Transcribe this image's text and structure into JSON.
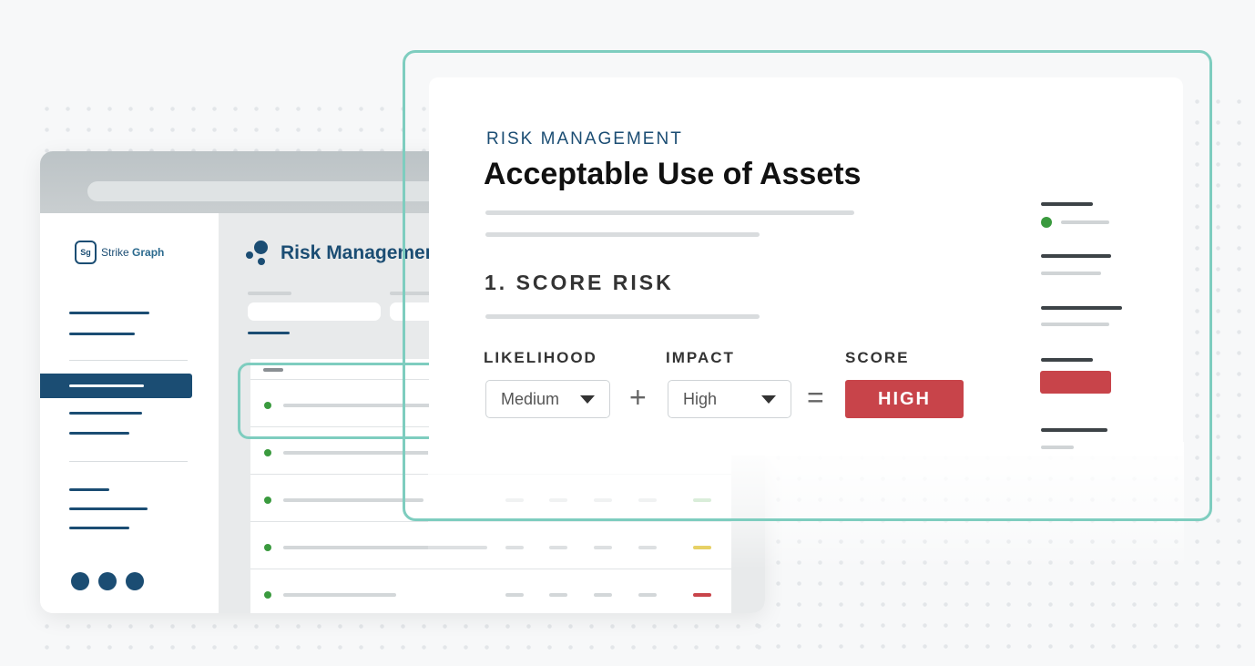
{
  "back_window": {
    "logo_mark": "Sg",
    "logo_name": "Strike ",
    "logo_name_bold": "Graph",
    "page_title": "Risk Management",
    "row_status_colors": [
      "#cfe6d0",
      "#8fc98f",
      "#e0c337",
      "#c8444a"
    ]
  },
  "front_card": {
    "kicker": "RISK MANAGEMENT",
    "title": "Acceptable Use of Assets",
    "section": "1. SCORE RISK",
    "likelihood": {
      "label": "LIKELIHOOD",
      "value": "Medium"
    },
    "operator_plus": "+",
    "impact": {
      "label": "IMPACT",
      "value": "High"
    },
    "operator_equals": "=",
    "score": {
      "label": "SCORE",
      "value": "HIGH",
      "color": "#c8444a"
    }
  },
  "colors": {
    "brand_navy": "#1b4d73",
    "accent_teal": "#7ecdbf",
    "status_green": "#3a9a3e",
    "status_red": "#c8444a"
  }
}
